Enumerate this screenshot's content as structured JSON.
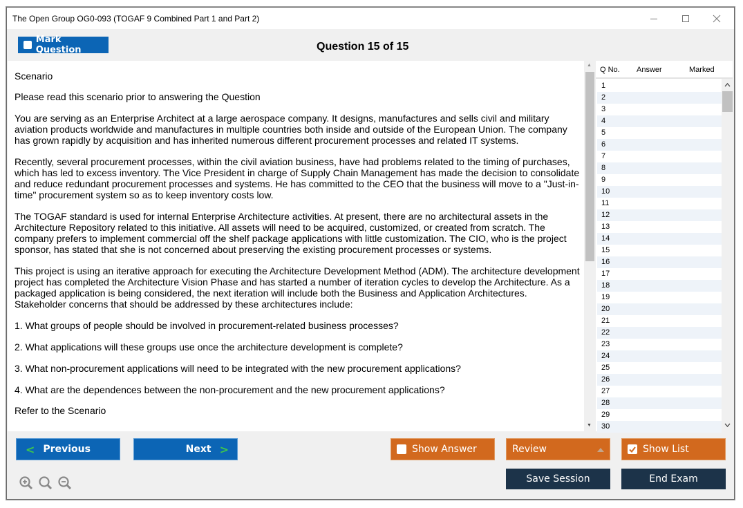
{
  "window": {
    "title": "The Open Group OG0-093 (TOGAF 9 Combined Part 1 and Part 2)",
    "controls": [
      "minimize",
      "maximize",
      "close"
    ]
  },
  "topbar": {
    "mark_label": "Mark Question",
    "mark_checked": false,
    "heading": "Question 15 of 15"
  },
  "content": {
    "paragraphs": [
      "Scenario",
      "Please read this scenario prior to answering the Question",
      "You are serving as an Enterprise Architect at a large aerospace company. It designs, manufactures and sells civil and military aviation products worldwide and manufactures in multiple countries both inside and outside of the European Union. The company has grown rapidly by acquisition and has inherited numerous different procurement processes and related IT systems.",
      "Recently, several procurement processes, within the civil aviation business, have had problems related to the timing of purchases, which has led to excess inventory. The Vice President in charge of Supply Chain Management has made the decision to consolidate and reduce redundant procurement processes and systems. He has committed to the CEO that the business will move to a \"Just-in-time\" procurement system so as to keep inventory costs low.",
      "The TOGAF standard is used for internal Enterprise Architecture activities. At present, there are no architectural assets in the Architecture Repository related to this initiative. All assets will need to be acquired, customized, or created from scratch. The company prefers to implement commercial off the shelf package applications with little customization. The CIO, who is the project sponsor, has stated that she is not concerned about preserving the existing procurement processes or systems.",
      "This project is using an iterative approach for executing the Architecture Development Method (ADM). The architecture development project has completed the Architecture Vision Phase and has started a number of iteration cycles to develop the Architecture. As a packaged application is being considered, the next iteration will include both the Business and Application Architectures. Stakeholder concerns that should be addressed by these architectures include:",
      "1. What groups of people should be involved in procurement-related business processes?",
      "2. What applications will these groups use once the architecture development is complete?",
      "3. What non-procurement applications will need to be integrated with the new procurement applications?",
      "4. What are the dependences between the non-procurement and the new procurement applications?",
      "Refer to the Scenario"
    ]
  },
  "question_list": {
    "headers": [
      "Q No.",
      "Answer",
      "Marked"
    ],
    "rows": [
      "1",
      "2",
      "3",
      "4",
      "5",
      "6",
      "7",
      "8",
      "9",
      "10",
      "11",
      "12",
      "13",
      "14",
      "15",
      "16",
      "17",
      "18",
      "19",
      "20",
      "21",
      "22",
      "23",
      "24",
      "25",
      "26",
      "27",
      "28",
      "29",
      "30"
    ]
  },
  "footer": {
    "previous_label": "Previous",
    "next_label": "Next",
    "show_answer_label": "Show Answer",
    "show_answer_checked": false,
    "review_label": "Review",
    "show_list_label": "Show List",
    "show_list_checked": true,
    "save_session_label": "Save Session",
    "end_exam_label": "End Exam",
    "zoom_icons": [
      "zoom-in",
      "zoom-reset",
      "zoom-out"
    ]
  },
  "colors": {
    "primary_blue": "#0c65b5",
    "orange": "#d2691e",
    "navy": "#1c3349",
    "chevron_green": "#3fc94a"
  }
}
